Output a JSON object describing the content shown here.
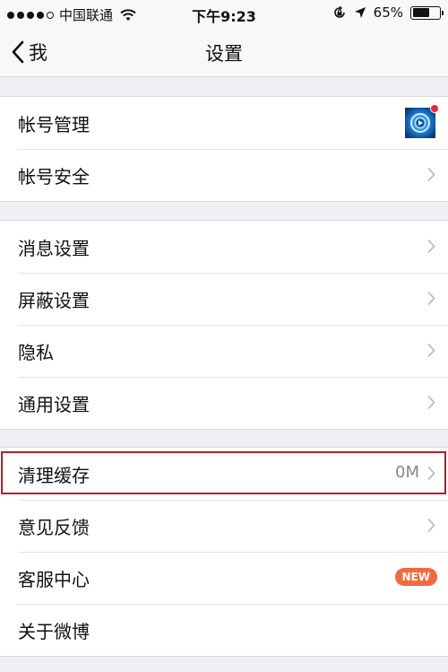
{
  "status_bar": {
    "carrier": "中国联通",
    "time": "下午9:23",
    "battery_text": "65%",
    "battery_level": 0.65,
    "signal_bars": 4
  },
  "nav": {
    "back_label": "我",
    "title": "设置"
  },
  "groups": [
    {
      "items": [
        {
          "label": "帐号管理",
          "accessory": "avatar",
          "avatar_icon": "account-avatar-icon",
          "has_dot": true
        },
        {
          "label": "帐号安全",
          "accessory": "chevron"
        }
      ]
    },
    {
      "items": [
        {
          "label": "消息设置",
          "accessory": "chevron"
        },
        {
          "label": "屏蔽设置",
          "accessory": "chevron"
        },
        {
          "label": "隐私",
          "accessory": "chevron"
        },
        {
          "label": "通用设置",
          "accessory": "chevron"
        }
      ]
    },
    {
      "items": [
        {
          "label": "清理缓存",
          "accessory": "chevron",
          "value": "0M",
          "highlighted": true
        },
        {
          "label": "意见反馈",
          "accessory": "chevron"
        },
        {
          "label": "客服中心",
          "accessory": "badge",
          "badge": "NEW"
        },
        {
          "label": "关于微博",
          "accessory": "none"
        }
      ]
    }
  ],
  "colors": {
    "background": "#efeff4",
    "badge": "#f26a3d",
    "highlight_border": "#b01f2a",
    "notification_dot": "#e8272f"
  }
}
